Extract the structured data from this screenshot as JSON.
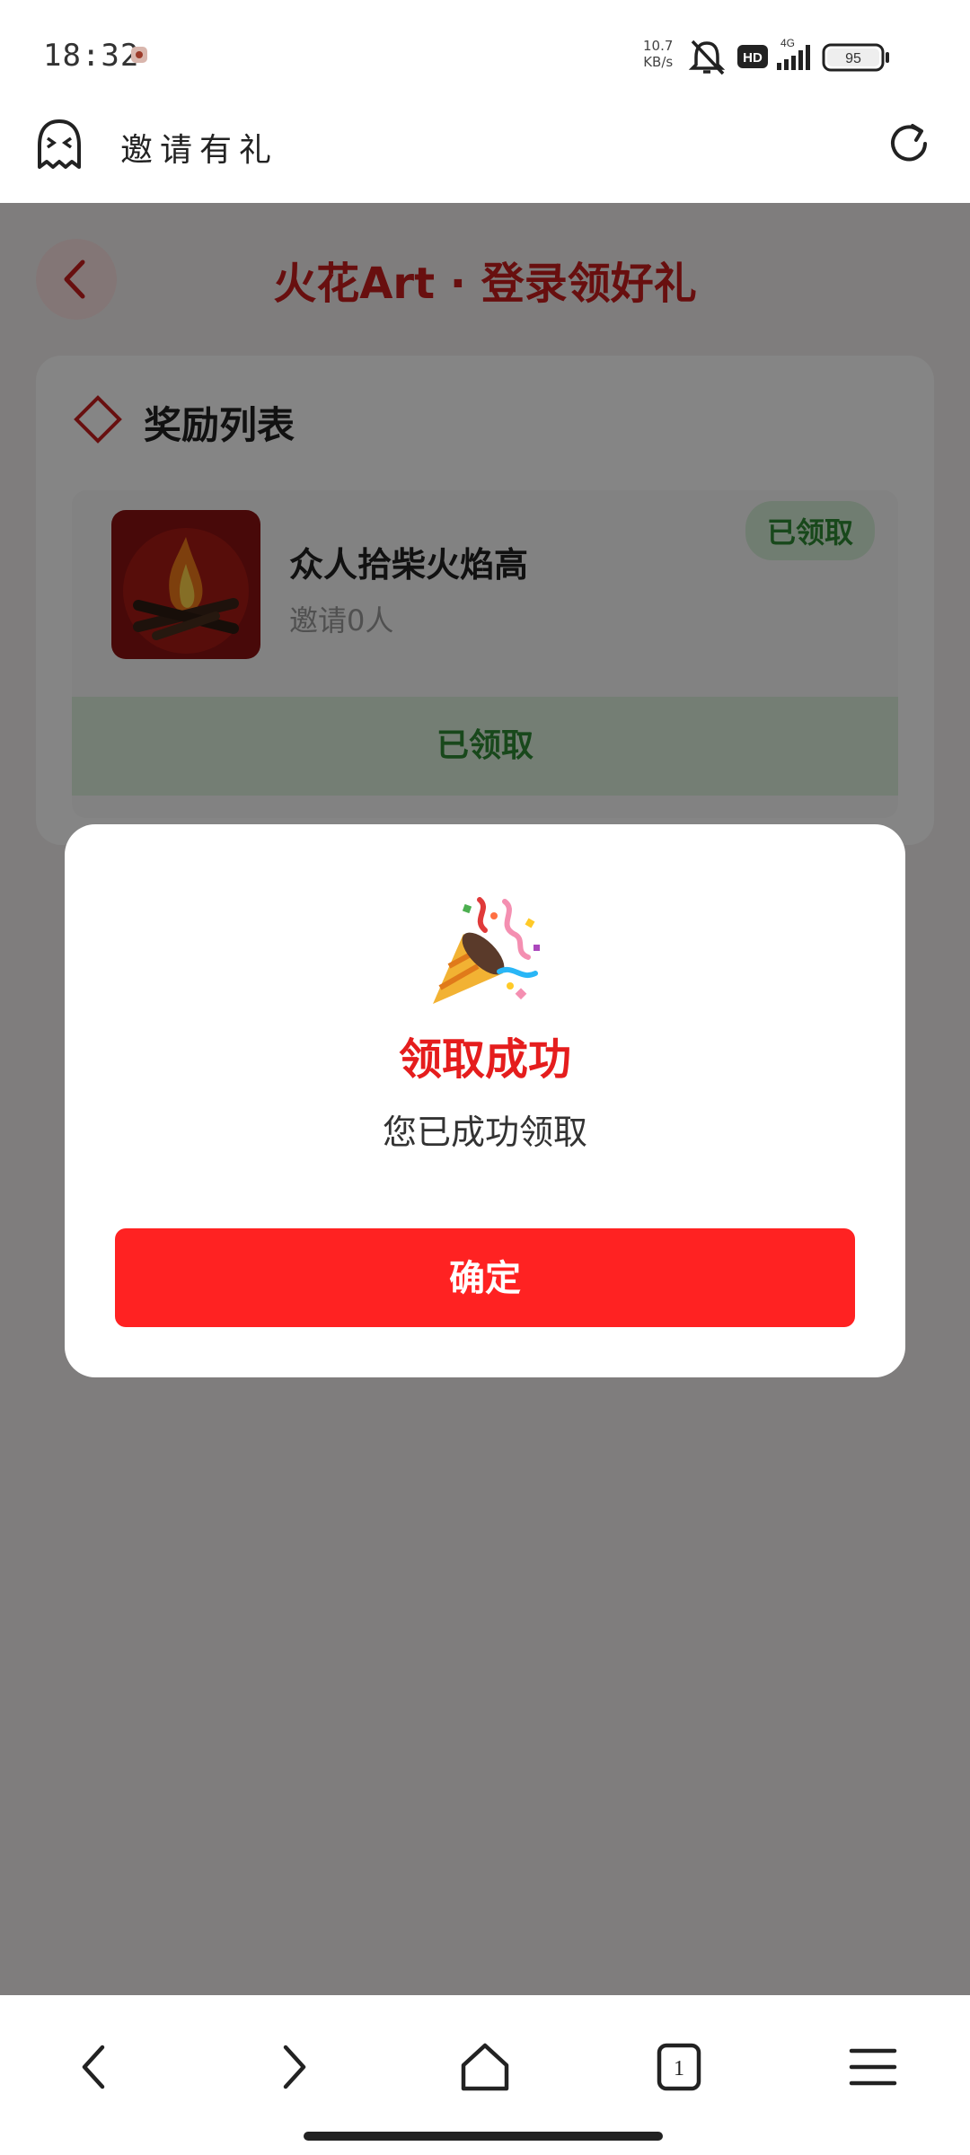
{
  "status_bar": {
    "time": "18:32",
    "net_speed_value": "10.7",
    "net_speed_unit": "KB/s",
    "hd_label": "HD",
    "network_label": "4G",
    "battery": "95"
  },
  "browser": {
    "title": "邀请有礼"
  },
  "page": {
    "title": "火花Art · 登录领好礼",
    "rewards_heading": "奖励列表",
    "items": [
      {
        "name": "众人拾柴火焰高",
        "subtitle": "邀请0人",
        "badge": "已领取",
        "button": "已领取"
      }
    ]
  },
  "modal": {
    "title": "领取成功",
    "message": "您已成功领取",
    "confirm_label": "确定"
  },
  "bottom_nav": {
    "tab_count": "1"
  },
  "colors": {
    "accent_red": "#e51d1d",
    "button_red": "#ff2222",
    "claimed_green": "#2f8a34"
  }
}
